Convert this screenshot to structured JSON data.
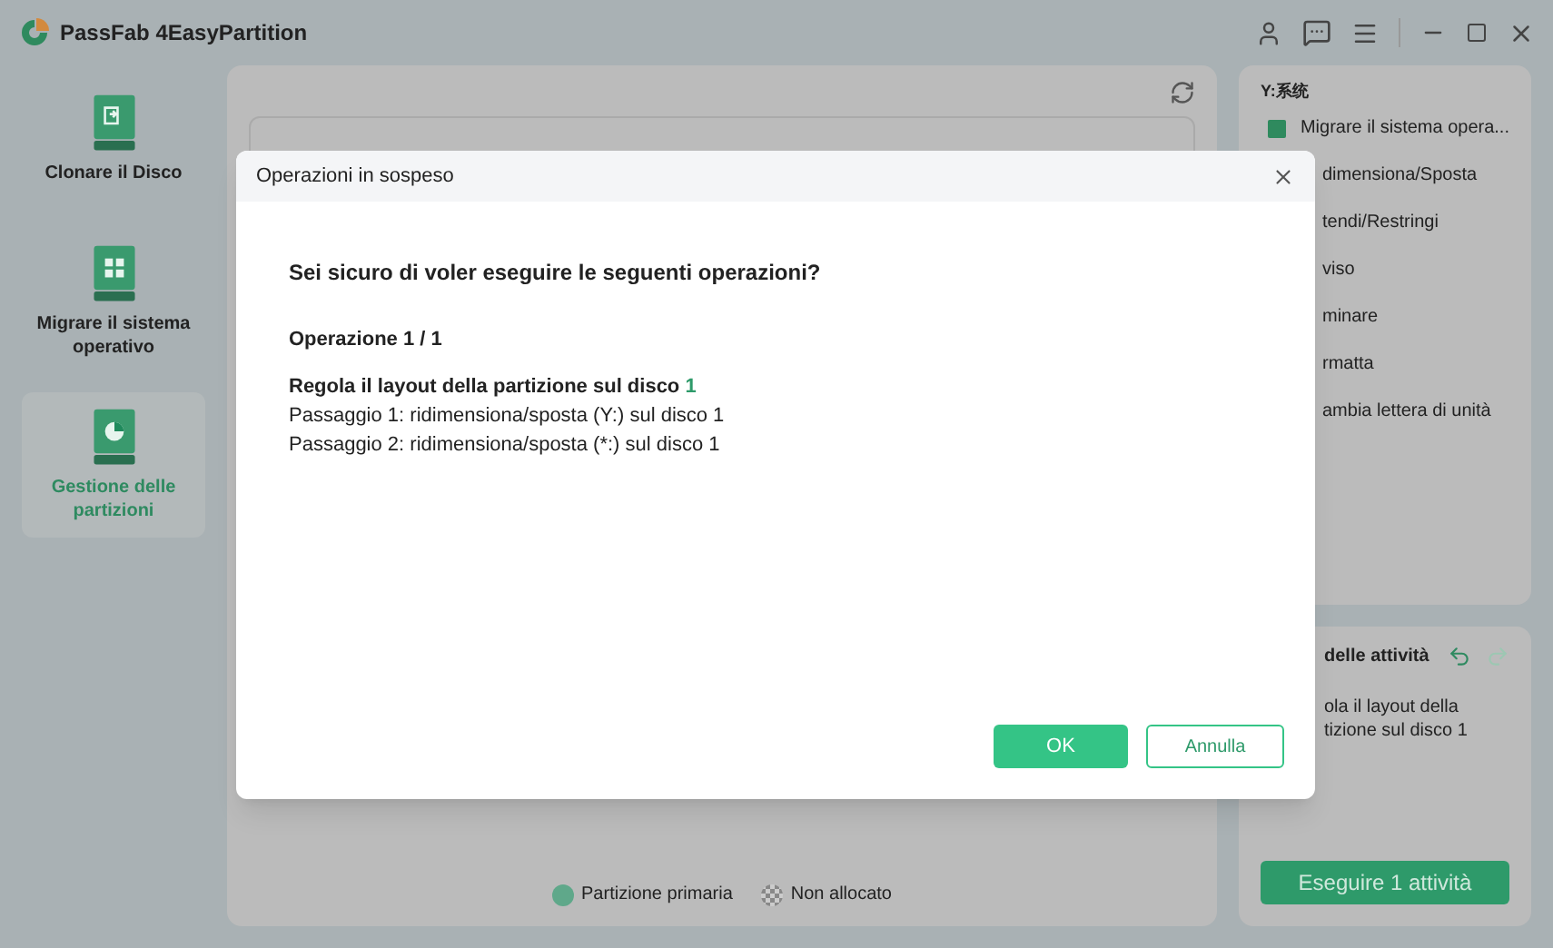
{
  "app": {
    "title": "PassFab 4EasyPartition"
  },
  "sidebar": {
    "items": [
      {
        "label": "Clonare il Disco",
        "kind": "clone",
        "selected": false
      },
      {
        "label": "Migrare il sistema operativo",
        "kind": "migrate",
        "selected": false
      },
      {
        "label": "Gestione delle partizioni",
        "kind": "partition",
        "selected": true
      }
    ]
  },
  "legend": [
    {
      "label": "Partizione primaria",
      "kind": "primary"
    },
    {
      "label": "Non allocato",
      "kind": "unallocated"
    }
  ],
  "properties": {
    "title": "Y:系统",
    "actions": [
      "Migrare il sistema opera...",
      "dimensiona/Sposta",
      "tendi/Restringi",
      "viso",
      "minare",
      "rmatta",
      "ambia lettera di unità"
    ]
  },
  "tasks": {
    "title": "delle attività",
    "items": [
      "ola il layout della",
      "tizione sul disco 1"
    ],
    "button": "Eseguire 1 attività"
  },
  "dialog": {
    "title": "Operazioni in sospeso",
    "question": "Sei sicuro di voler eseguire le seguenti operazioni?",
    "counter": "Operazione 1 / 1",
    "operation": "Regola il layout della partizione sul disco",
    "disk": "1",
    "steps": [
      "Passaggio 1: ridimensiona/sposta (Y:) sul disco 1",
      "Passaggio 2: ridimensiona/sposta (*:) sul disco 1"
    ],
    "ok": "OK",
    "cancel": "Annulla"
  }
}
